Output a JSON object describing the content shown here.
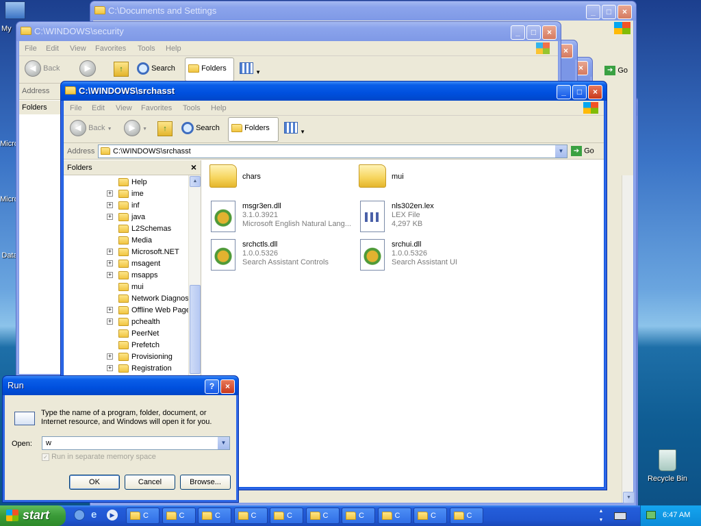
{
  "desktop": {
    "icons": [
      {
        "label": "My",
        "icon": "my-computer-icon"
      },
      {
        "label": "Micro",
        "icon": "generic-icon"
      },
      {
        "label": "Micro",
        "icon": "generic-icon"
      },
      {
        "label": "Data",
        "icon": "generic-icon"
      }
    ],
    "recycle_bin": "Recycle Bin"
  },
  "windows": {
    "docs": {
      "title": "C:\\Documents and Settings"
    },
    "security": {
      "title": "C:\\WINDOWS\\security",
      "menus": [
        "File",
        "Edit",
        "View",
        "Favorites",
        "Tools",
        "Help"
      ],
      "back": "Back",
      "search": "Search",
      "folders": "Folders",
      "address_label": "Address",
      "folders_pane": "Folders"
    },
    "go_label": "Go",
    "main": {
      "title": "C:\\WINDOWS\\srchasst",
      "menus": [
        "File",
        "Edit",
        "View",
        "Favorites",
        "Tools",
        "Help"
      ],
      "back": "Back",
      "search": "Search",
      "folders": "Folders",
      "address_label": "Address",
      "address_value": "C:\\WINDOWS\\srchasst",
      "go": "Go",
      "folders_pane": "Folders",
      "close_glyph": "×",
      "tree": [
        {
          "label": "Help",
          "expand": false
        },
        {
          "label": "ime",
          "expand": true
        },
        {
          "label": "inf",
          "expand": true
        },
        {
          "label": "java",
          "expand": true
        },
        {
          "label": "L2Schemas",
          "expand": false
        },
        {
          "label": "Media",
          "expand": false
        },
        {
          "label": "Microsoft.NET",
          "expand": true
        },
        {
          "label": "msagent",
          "expand": true
        },
        {
          "label": "msapps",
          "expand": true
        },
        {
          "label": "mui",
          "expand": false
        },
        {
          "label": "Network Diagnost",
          "expand": false
        },
        {
          "label": "Offline Web Page",
          "expand": true
        },
        {
          "label": "pchealth",
          "expand": true
        },
        {
          "label": "PeerNet",
          "expand": false
        },
        {
          "label": "Prefetch",
          "expand": false
        },
        {
          "label": "Provisioning",
          "expand": true
        },
        {
          "label": "Registration",
          "expand": true
        }
      ],
      "files": [
        {
          "name": "chars",
          "line1": "",
          "line2": "",
          "icon": "folder-icon"
        },
        {
          "name": "mui",
          "line1": "",
          "line2": "",
          "icon": "folder-icon"
        },
        {
          "name": "msgr3en.dll",
          "line1": "3.1.0.3921",
          "line2": "Microsoft English Natural Lang...",
          "icon": "dll-file-icon"
        },
        {
          "name": "nls302en.lex",
          "line1": "LEX File",
          "line2": "4,297 KB",
          "icon": "lex-file-icon"
        },
        {
          "name": "srchctls.dll",
          "line1": "1.0.0.5326",
          "line2": "Search Assistant Controls",
          "icon": "dll-file-icon"
        },
        {
          "name": "srchui.dll",
          "line1": "1.0.0.5326",
          "line2": "Search Assistant UI",
          "icon": "dll-file-icon"
        }
      ]
    }
  },
  "run_dialog": {
    "title": "Run",
    "help": "?",
    "close": "×",
    "description": "Type the name of a program, folder, document, or Internet resource, and Windows will open it for you.",
    "open_label": "Open:",
    "open_value": "w",
    "checkbox_label": "Run in separate memory space",
    "ok": "OK",
    "cancel": "Cancel",
    "browse": "Browse..."
  },
  "taskbar": {
    "start": "start",
    "items": [
      "C",
      "C",
      "C",
      "C",
      "C",
      "C",
      "C",
      "C",
      "C",
      "C"
    ],
    "clock": "6:47 AM"
  }
}
